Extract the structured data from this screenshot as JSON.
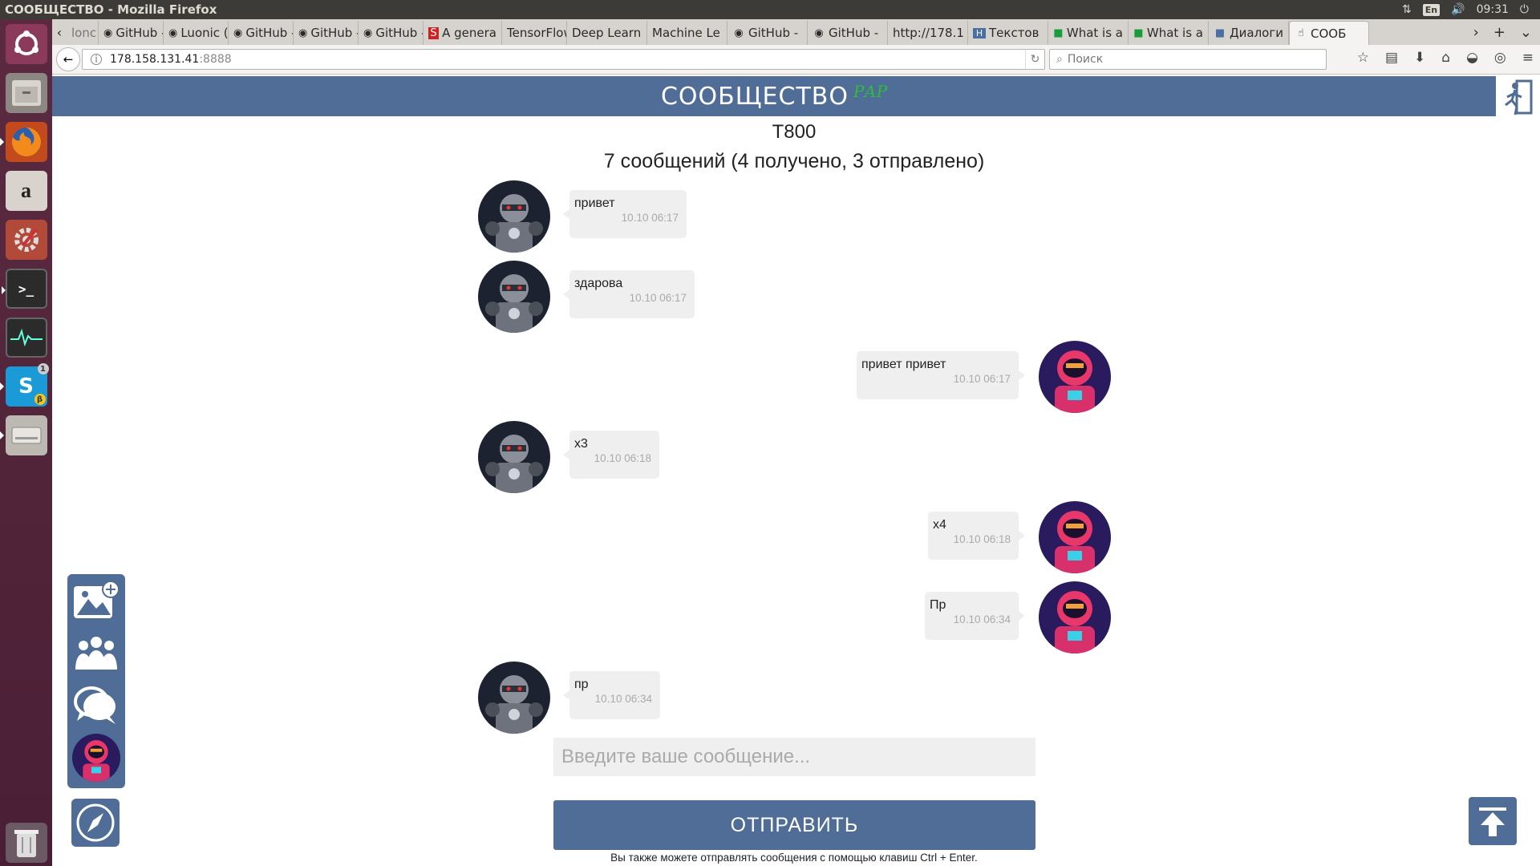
{
  "os": {
    "window_title": "СООБЩЕСТВО - Mozilla Firefox",
    "keyboard_lang": "En",
    "clock": "09:31"
  },
  "launcher": {
    "items": [
      "ubuntu-dash-icon",
      "files-icon",
      "firefox-icon",
      "amazon-icon",
      "settings-icon",
      "terminal-icon",
      "system-monitor-icon",
      "skype-icon",
      "disk-icon",
      "trash-icon"
    ],
    "skype_badge": "1",
    "skype_beta": "β",
    "amazon_letter": "a"
  },
  "browser": {
    "tabs": [
      {
        "label": "lonc",
        "favicon": ""
      },
      {
        "label": "GitHub -",
        "favicon": "github-icon"
      },
      {
        "label": "Luonic (/",
        "favicon": "github-icon"
      },
      {
        "label": "GitHub -",
        "favicon": "github-icon"
      },
      {
        "label": "GitHub -",
        "favicon": "github-icon"
      },
      {
        "label": "GitHub -",
        "favicon": "github-icon"
      },
      {
        "label": "A genera",
        "favicon": "s-icon"
      },
      {
        "label": "TensorFlow",
        "favicon": ""
      },
      {
        "label": "Deep Learn",
        "favicon": ""
      },
      {
        "label": "Machine Le",
        "favicon": ""
      },
      {
        "label": "GitHub -",
        "favicon": "github-icon"
      },
      {
        "label": "GitHub -",
        "favicon": "github-icon"
      },
      {
        "label": "http://178.1",
        "favicon": ""
      },
      {
        "label": "Текстов",
        "favicon": "h-icon"
      },
      {
        "label": "What is a",
        "favicon": "green-icon"
      },
      {
        "label": "What is a",
        "favicon": "green-icon"
      },
      {
        "label": "Диалоги",
        "favicon": "vk-icon"
      },
      {
        "label": "СООБ",
        "favicon": "hand-icon",
        "active": true
      }
    ],
    "url_host": "178.158.131.41",
    "url_port": ":8888",
    "search_placeholder": "Поиск"
  },
  "app": {
    "title": "СООБЩЕСТВО",
    "beta_label": "РАР",
    "contact_name": "T800",
    "summary": "7 сообщений (4 получено, 3 отправлено)",
    "messages": [
      {
        "direction": "in",
        "text": "привет",
        "time": "10.10 06:17",
        "avatar": "robot-avatar"
      },
      {
        "direction": "in",
        "text": "здарова",
        "time": "10.10 06:17",
        "avatar": "robot-avatar"
      },
      {
        "direction": "out",
        "text": "привет привет",
        "time": "10.10 06:17",
        "avatar": "astronaut-avatar"
      },
      {
        "direction": "in",
        "text": "x3",
        "time": "10.10 06:18",
        "avatar": "robot-avatar"
      },
      {
        "direction": "out",
        "text": "x4",
        "time": "10.10 06:18",
        "avatar": "astronaut-avatar"
      },
      {
        "direction": "out",
        "text": "Пр",
        "time": "10.10 06:34",
        "avatar": "astronaut-avatar"
      },
      {
        "direction": "in",
        "text": "пр",
        "time": "10.10 06:34",
        "avatar": "robot-avatar"
      }
    ],
    "input_placeholder": "Введите ваше сообщение...",
    "send_label": "ОТПРАВИТЬ",
    "hint": "Вы также можете отправлять сообщения с помощью клавиш Ctrl + Enter.",
    "colors": {
      "primary": "#4f6d96",
      "beta": "#2bbf3a",
      "bubble": "#efefef"
    }
  }
}
